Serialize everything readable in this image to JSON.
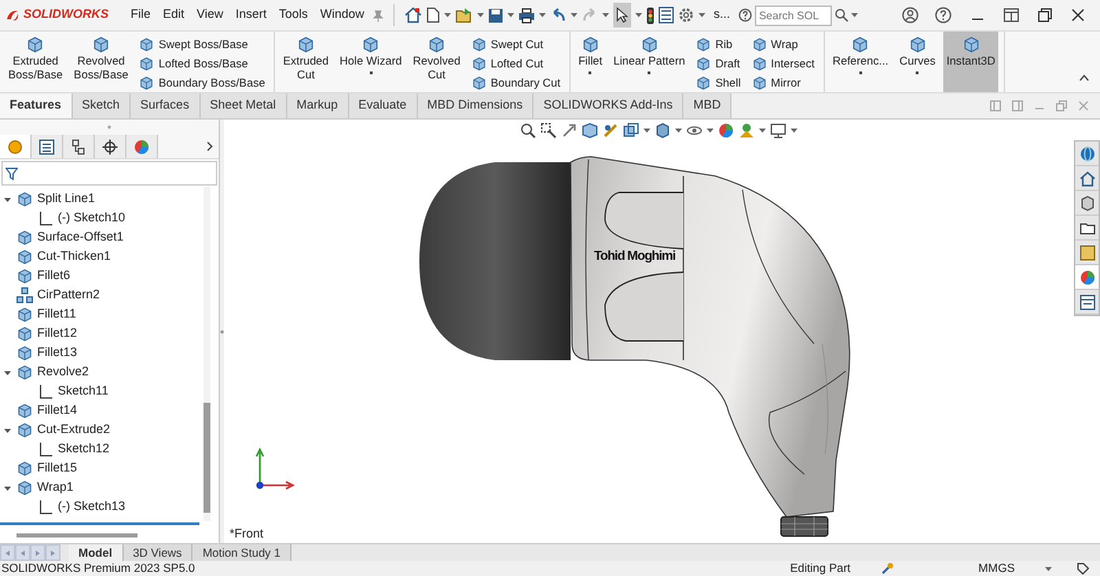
{
  "title_bar": {
    "logo": "SOLIDWORKS",
    "menu": [
      "File",
      "Edit",
      "View",
      "Insert",
      "Tools",
      "Window"
    ],
    "search_prefix": "s...",
    "search": {
      "placeholder": "Search SOL"
    }
  },
  "ribbon": [
    {
      "items": [
        {
          "kind": "large",
          "label": "Extruded\nBoss/Base",
          "dropdown": false,
          "on": false
        },
        {
          "kind": "large",
          "label": "Revolved\nBoss/Base",
          "dropdown": false,
          "on": false
        },
        {
          "kind": "stack",
          "items": [
            "Swept Boss/Base",
            "Lofted Boss/Base",
            "Boundary Boss/Base"
          ]
        }
      ]
    },
    {
      "items": [
        {
          "kind": "large",
          "label": "Extruded\nCut",
          "dropdown": false,
          "on": false
        },
        {
          "kind": "large",
          "label": "Hole Wizard",
          "dropdown": true,
          "on": false
        },
        {
          "kind": "large",
          "label": "Revolved\nCut",
          "dropdown": false,
          "on": false
        },
        {
          "kind": "stack",
          "items": [
            "Swept Cut",
            "Lofted Cut",
            "Boundary Cut"
          ]
        }
      ]
    },
    {
      "items": [
        {
          "kind": "large",
          "label": "Fillet",
          "dropdown": true,
          "on": false
        },
        {
          "kind": "large",
          "label": "Linear Pattern",
          "dropdown": true,
          "on": false
        },
        {
          "kind": "stack",
          "items": [
            "Rib",
            "Draft",
            "Shell"
          ]
        },
        {
          "kind": "stack",
          "items": [
            "Wrap",
            "Intersect",
            "Mirror"
          ]
        }
      ]
    },
    {
      "items": [
        {
          "kind": "large",
          "label": "Referenc...",
          "dropdown": true,
          "on": false
        },
        {
          "kind": "large",
          "label": "Curves",
          "dropdown": true,
          "on": false
        },
        {
          "kind": "large",
          "label": "Instant3D",
          "dropdown": false,
          "on": true
        }
      ]
    }
  ],
  "tabs": [
    {
      "label": "Features",
      "selected": true
    },
    {
      "label": "Sketch",
      "selected": false
    },
    {
      "label": "Surfaces",
      "selected": false
    },
    {
      "label": "Sheet Metal",
      "selected": false
    },
    {
      "label": "Markup",
      "selected": false
    },
    {
      "label": "Evaluate",
      "selected": false
    },
    {
      "label": "MBD Dimensions",
      "selected": false
    },
    {
      "label": "SOLIDWORKS Add-Ins",
      "selected": false
    },
    {
      "label": "MBD",
      "selected": false
    }
  ],
  "panel_tabs": [
    {
      "selected": true
    },
    {
      "selected": false
    },
    {
      "selected": false
    },
    {
      "selected": false
    },
    {
      "selected": false
    }
  ],
  "feature_tree": [
    {
      "label": "Split Line1",
      "kind": "feature",
      "expanded": true,
      "children": [
        {
          "label": "(-) Sketch10",
          "kind": "sketch"
        }
      ]
    },
    {
      "label": "Surface-Offset1",
      "kind": "feature"
    },
    {
      "label": "Cut-Thicken1",
      "kind": "feature"
    },
    {
      "label": "Fillet6",
      "kind": "feature"
    },
    {
      "label": "CirPattern2",
      "kind": "pattern"
    },
    {
      "label": "Fillet11",
      "kind": "feature"
    },
    {
      "label": "Fillet12",
      "kind": "feature"
    },
    {
      "label": "Fillet13",
      "kind": "feature"
    },
    {
      "label": "Revolve2",
      "kind": "feature",
      "expanded": true,
      "children": [
        {
          "label": "Sketch11",
          "kind": "sketch"
        }
      ]
    },
    {
      "label": "Fillet14",
      "kind": "feature"
    },
    {
      "label": "Cut-Extrude2",
      "kind": "feature",
      "expanded": true,
      "children": [
        {
          "label": "Sketch12",
          "kind": "sketch"
        }
      ]
    },
    {
      "label": "Fillet15",
      "kind": "feature"
    },
    {
      "label": "Wrap1",
      "kind": "feature",
      "expanded": true,
      "children": [
        {
          "label": "(-) Sketch13",
          "kind": "sketch"
        }
      ]
    }
  ],
  "viewport": {
    "model_engraving": "Tohid Moghimi",
    "view_name": "*Front"
  },
  "task_pane": [
    {
      "selected": false
    },
    {
      "selected": false
    },
    {
      "selected": false
    },
    {
      "selected": false
    },
    {
      "selected": false
    },
    {
      "selected": true
    },
    {
      "selected": false
    }
  ],
  "bottom_tabs": [
    {
      "label": "Model",
      "selected": true
    },
    {
      "label": "3D Views",
      "selected": false
    },
    {
      "label": "Motion Study 1",
      "selected": false
    }
  ],
  "status_bar": {
    "product": "SOLIDWORKS Premium 2023 SP5.0",
    "mode": "Editing Part",
    "units": "MMGS"
  }
}
